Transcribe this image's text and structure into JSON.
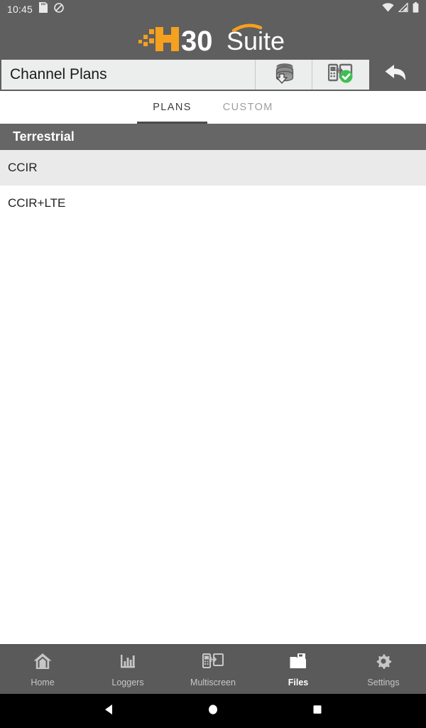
{
  "status_bar": {
    "time": "10:45",
    "icons_left": [
      "sdcard-icon",
      "do-not-disturb-icon"
    ],
    "icons_right": [
      "wifi-icon",
      "cellular-signal-icon",
      "battery-icon"
    ]
  },
  "brand": {
    "logo_h": "H",
    "logo_30": "30",
    "logo_suite": "Suite",
    "accent_color": "#F5A01E",
    "text_color": "#FFFFFF"
  },
  "toolbar": {
    "title": "Channel Plans",
    "buttons": [
      {
        "name": "load-plan-button",
        "icon": "database-download-icon"
      },
      {
        "name": "apply-plan-button",
        "icon": "multiscreen-check-icon"
      }
    ],
    "back_label": "back-arrow-icon"
  },
  "tabs": [
    {
      "label": "PLANS",
      "active": true
    },
    {
      "label": "CUSTOM",
      "active": false
    }
  ],
  "content": {
    "section_title": "Terrestrial",
    "items": [
      {
        "label": "CCIR",
        "selected": true
      },
      {
        "label": "CCIR+LTE",
        "selected": false
      }
    ]
  },
  "bottom_nav": [
    {
      "label": "Home",
      "icon": "home-icon",
      "active": false
    },
    {
      "label": "Loggers",
      "icon": "bar-chart-icon",
      "active": false
    },
    {
      "label": "Multiscreen",
      "icon": "multiscreen-icon",
      "active": false
    },
    {
      "label": "Files",
      "icon": "folder-icon",
      "active": true
    },
    {
      "label": "Settings",
      "icon": "gear-icon",
      "active": false
    }
  ],
  "android_nav": {
    "back": "android-back-icon",
    "home": "android-home-icon",
    "recents": "android-recents-icon"
  },
  "colors": {
    "chrome_gray": "#5f5f5f",
    "section_gray": "#666666",
    "selected_row": "#eaeaea",
    "toolbar_panel": "#eceded",
    "success_green": "#3FBF52"
  }
}
